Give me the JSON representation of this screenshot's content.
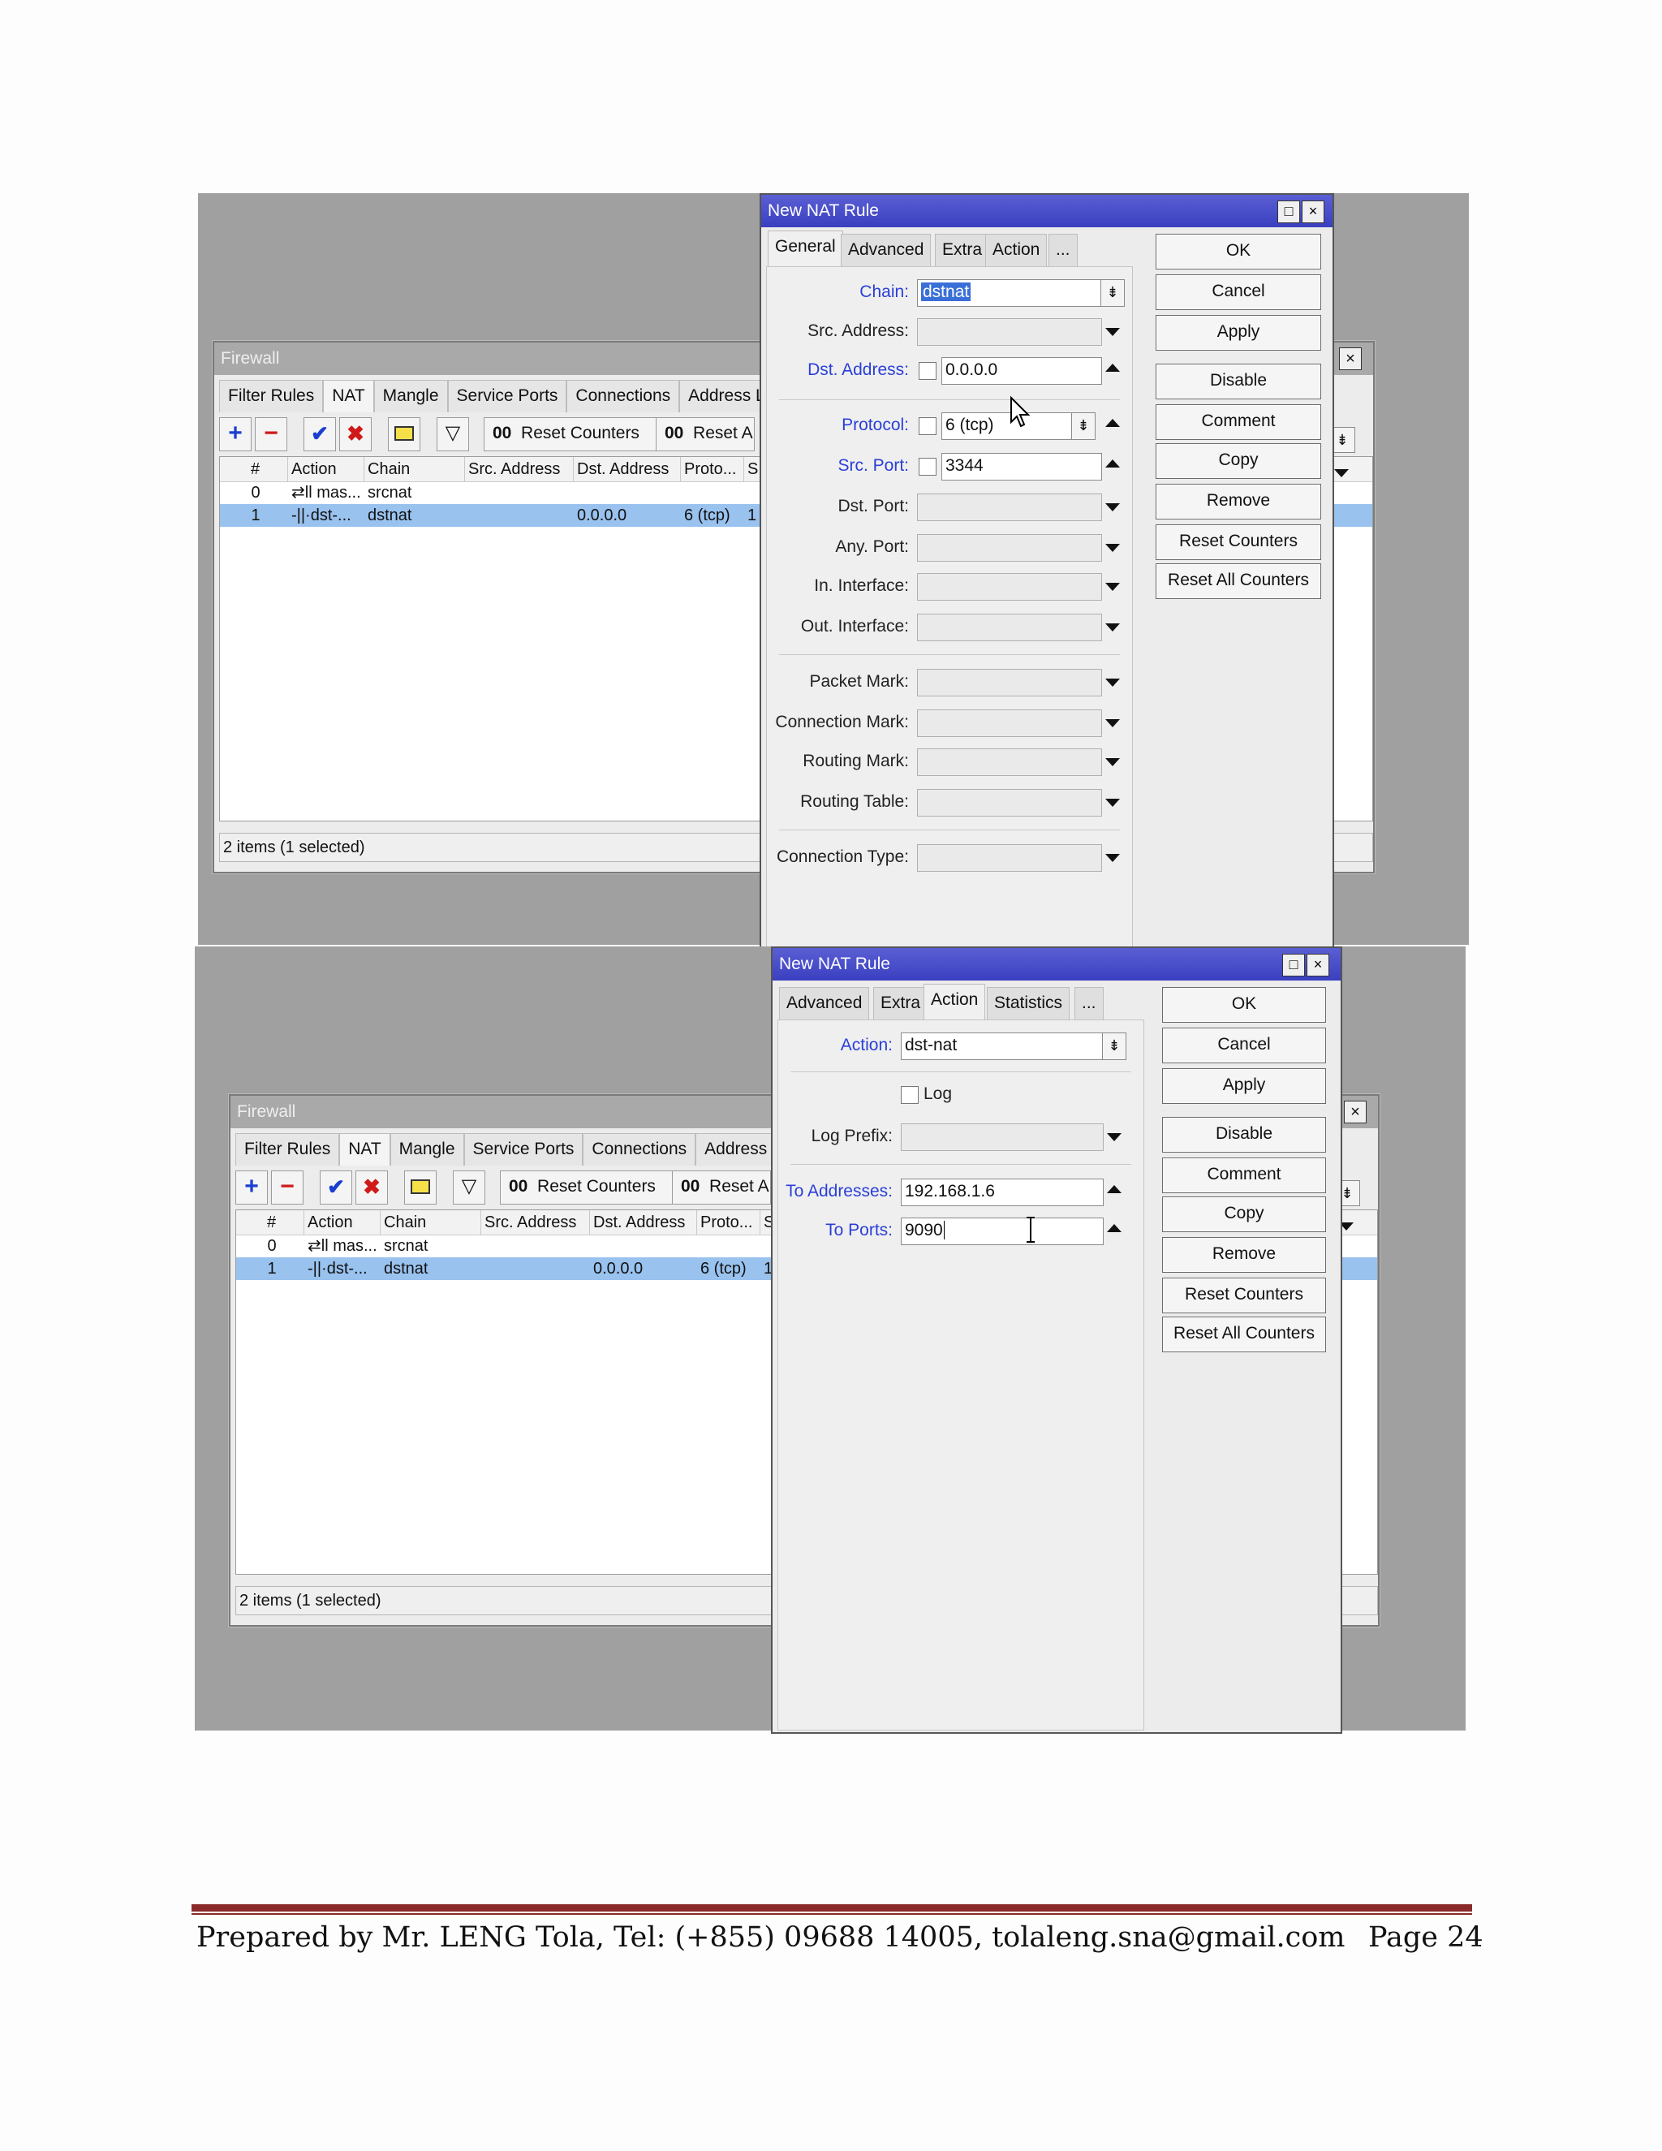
{
  "firewall": {
    "title": "Firewall",
    "tabs": [
      "Filter Rules",
      "NAT",
      "Mangle",
      "Service Ports",
      "Connections",
      "Address Lis"
    ],
    "toolbar": {
      "reset_counters": "Reset Counters",
      "reset_all": "Reset A",
      "counter_glyph": "00"
    },
    "columns": [
      "#",
      "Action",
      "Chain",
      "Src. Address",
      "Dst. Address",
      "Proto...",
      "S"
    ],
    "rows": [
      {
        "num": "0",
        "action": "⇄ll mas...",
        "chain": "srcnat",
        "src": "",
        "dst": "",
        "proto": "",
        "s": ""
      },
      {
        "num": "1",
        "action": "-||·dst-...",
        "chain": "dstnat",
        "src": "",
        "dst": "0.0.0.0",
        "proto": "6 (tcp)",
        "s": "1"
      }
    ],
    "status": "2 items (1 selected)"
  },
  "dialog1": {
    "title": "New NAT Rule",
    "tabs": [
      "General",
      "Advanced",
      "Extra",
      "Action",
      "..."
    ],
    "fields": {
      "chain_label": "Chain:",
      "chain_value": "dstnat",
      "src_address_label": "Src. Address:",
      "dst_address_label": "Dst. Address:",
      "dst_address_value": "0.0.0.0",
      "protocol_label": "Protocol:",
      "protocol_value": "6 (tcp)",
      "src_port_label": "Src. Port:",
      "src_port_value": "3344",
      "dst_port_label": "Dst. Port:",
      "any_port_label": "Any. Port:",
      "in_interface_label": "In. Interface:",
      "out_interface_label": "Out. Interface:",
      "packet_mark_label": "Packet Mark:",
      "connection_mark_label": "Connection Mark:",
      "routing_mark_label": "Routing Mark:",
      "routing_table_label": "Routing Table:",
      "connection_type_label": "Connection Type:"
    }
  },
  "dialog2": {
    "title": "New NAT Rule",
    "tabs": [
      "Advanced",
      "Extra",
      "Action",
      "Statistics",
      "..."
    ],
    "fields": {
      "action_label": "Action:",
      "action_value": "dst-nat",
      "log_label": "Log",
      "log_prefix_label": "Log Prefix:",
      "to_addresses_label": "To Addresses:",
      "to_addresses_value": "192.168.1.6",
      "to_ports_label": "To Ports:",
      "to_ports_value": "9090"
    }
  },
  "buttons": [
    "OK",
    "Cancel",
    "Apply",
    "Disable",
    "Comment",
    "Copy",
    "Remove",
    "Reset Counters",
    "Reset All Counters"
  ],
  "footer": {
    "prepared_by": "Prepared by Mr. LENG Tola, Tel: (+855) 09688 14005, tolaleng.sna@gmail.com",
    "page": "Page 24"
  },
  "colors": {
    "dialog_title": "#3a3fc0",
    "selected_row": "#99c2ee",
    "footer_rule": "#8b2a2a",
    "label_blue": "#2a3fd8"
  }
}
